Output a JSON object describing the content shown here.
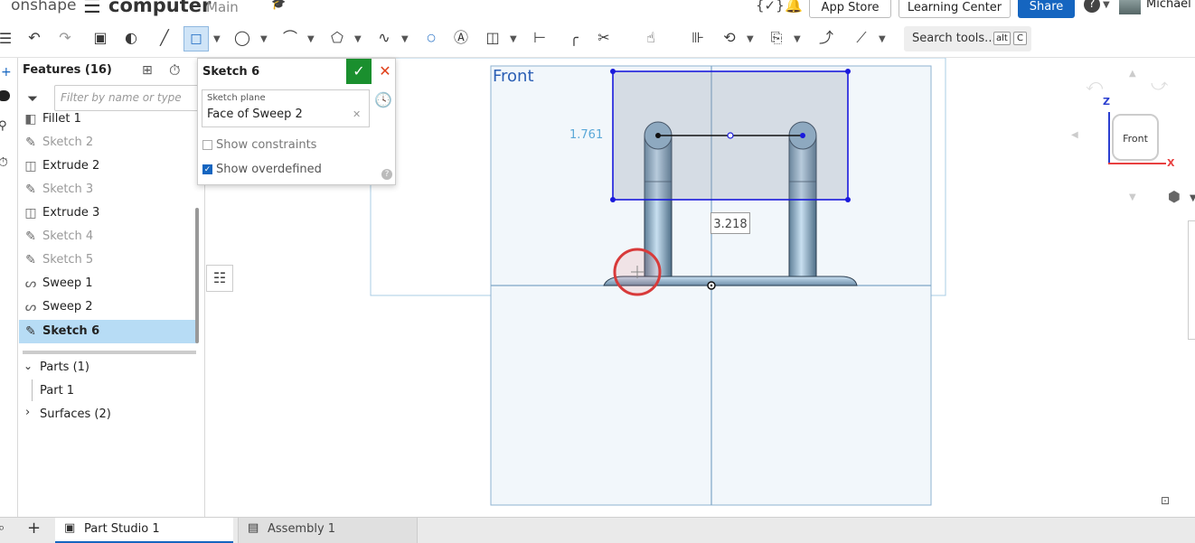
{
  "app": {
    "logo": "onshape",
    "doc_title": "computer",
    "branch": "Main"
  },
  "topbar": {
    "app_store": "App Store",
    "learning_center": "Learning Center",
    "share": "Share",
    "help": "?",
    "user": "Michael A"
  },
  "toolbar": {
    "search_placeholder": "Search tools...",
    "shortcut_alt": "alt",
    "shortcut_key": "C"
  },
  "features": {
    "header": "Features (16)",
    "filter_placeholder": "Filter by name or type",
    "items": [
      {
        "label": "Fillet 1",
        "icon": "fillet-icon",
        "state": "normal"
      },
      {
        "label": "Sketch 2",
        "icon": "sketch-icon",
        "state": "dim"
      },
      {
        "label": "Extrude 2",
        "icon": "extrude-icon",
        "state": "normal"
      },
      {
        "label": "Sketch 3",
        "icon": "sketch-icon",
        "state": "dim"
      },
      {
        "label": "Extrude 3",
        "icon": "extrude-icon",
        "state": "normal"
      },
      {
        "label": "Sketch 4",
        "icon": "sketch-icon",
        "state": "dim"
      },
      {
        "label": "Sketch 5",
        "icon": "sketch-icon",
        "state": "dim"
      },
      {
        "label": "Sweep 1",
        "icon": "sweep-icon",
        "state": "normal"
      },
      {
        "label": "Sweep 2",
        "icon": "sweep-icon",
        "state": "normal"
      },
      {
        "label": "Sketch 6",
        "icon": "sketch-icon",
        "state": "selected"
      }
    ],
    "parts_header": "Parts (1)",
    "part_1": "Part 1",
    "surfaces_header": "Surfaces (2)"
  },
  "sketch_dialog": {
    "title": "Sketch 6",
    "plane_label": "Sketch plane",
    "plane_value": "Face of Sweep 2",
    "show_constraints": "Show constraints",
    "show_overdefined": "Show overdefined",
    "show_constraints_checked": false,
    "show_overdefined_checked": true
  },
  "viewport": {
    "plane_label": "Front",
    "dim_vertical": "1.761",
    "dim_horizontal": "3.218",
    "viewcube_face": "Front",
    "axis_z": "Z",
    "axis_x": "X"
  },
  "tabs": [
    {
      "label": "Part Studio 1",
      "active": true
    },
    {
      "label": "Assembly 1",
      "active": false
    }
  ],
  "colors": {
    "accent": "#1565c0",
    "selection": "#b7dcf5",
    "sketch_blue": "#1a1adc",
    "confirm_green": "#1a8f2e",
    "cancel_red": "#e0401a"
  }
}
